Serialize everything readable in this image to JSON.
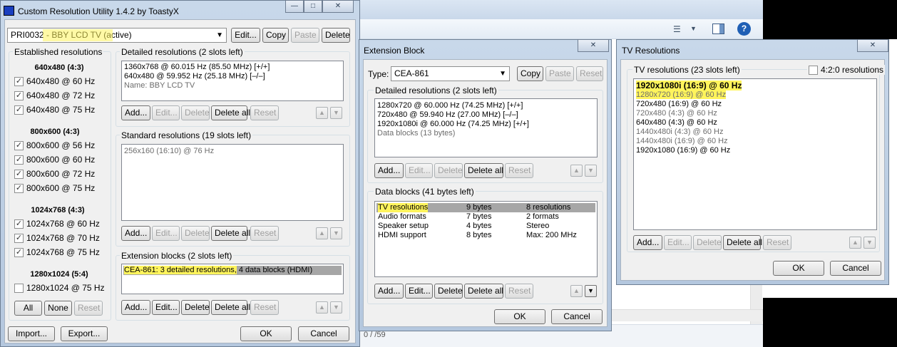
{
  "main_window": {
    "title": "Custom Resolution Utility 1.4.2 by ToastyX",
    "title_buttons": [
      "—",
      "□",
      "✕"
    ],
    "display_select": "PRI0032 - BBY LCD TV (active)",
    "top_buttons": {
      "edit": "Edit...",
      "copy": "Copy",
      "paste": "Paste",
      "delete": "Delete"
    },
    "established": {
      "title": "Established resolutions",
      "groups": [
        {
          "header": "640x480 (4:3)",
          "items": [
            {
              "label": "640x480 @ 60 Hz",
              "checked": true
            },
            {
              "label": "640x480 @ 72 Hz",
              "checked": true
            },
            {
              "label": "640x480 @ 75 Hz",
              "checked": true
            }
          ]
        },
        {
          "header": "800x600 (4:3)",
          "items": [
            {
              "label": "800x600 @ 56 Hz",
              "checked": true
            },
            {
              "label": "800x600 @ 60 Hz",
              "checked": true
            },
            {
              "label": "800x600 @ 72 Hz",
              "checked": true
            },
            {
              "label": "800x600 @ 75 Hz",
              "checked": true
            }
          ]
        },
        {
          "header": "1024x768 (4:3)",
          "items": [
            {
              "label": "1024x768 @ 60 Hz",
              "checked": true
            },
            {
              "label": "1024x768 @ 70 Hz",
              "checked": true
            },
            {
              "label": "1024x768 @ 75 Hz",
              "checked": true
            }
          ]
        },
        {
          "header": "1280x1024 (5:4)",
          "items": [
            {
              "label": "1280x1024 @ 75 Hz",
              "checked": false
            }
          ]
        }
      ],
      "buttons": {
        "all": "All",
        "none": "None",
        "reset": "Reset"
      }
    },
    "detailed": {
      "title": "Detailed resolutions (2 slots left)",
      "rows": [
        "1360x768 @ 60.015 Hz (85.50 MHz) [+/+]",
        "640x480 @ 59.952 Hz (25.18 MHz) [–/–]",
        "Name: BBY LCD TV"
      ]
    },
    "standard": {
      "title": "Standard resolutions (19 slots left)",
      "rows": [
        "256x160 (16:10) @ 76 Hz"
      ]
    },
    "extension": {
      "title": "Extension blocks (2 slots left)",
      "row_hl": "CEA-861: 3 detailed resolutions,",
      "row_rest": " 4 data blocks (HDMI)"
    },
    "list_buttons": {
      "add": "Add...",
      "edit": "Edit...",
      "delete": "Delete",
      "delete_all": "Delete all",
      "reset": "Reset",
      "up": "▲",
      "down": "▼"
    },
    "bottom": {
      "import": "Import...",
      "export": "Export...",
      "ok": "OK",
      "cancel": "Cancel"
    }
  },
  "ext_window": {
    "title": "Extension Block",
    "close": "✕",
    "type_label": "Type:",
    "type_value": "CEA-861",
    "buttons": {
      "copy": "Copy",
      "paste": "Paste",
      "reset": "Reset"
    },
    "detailed": {
      "title": "Detailed resolutions (2 slots left)",
      "rows": [
        "1280x720 @ 60.000 Hz (74.25 MHz) [+/+]",
        "720x480 @ 59.940 Hz (27.00 MHz) [–/–]",
        "1920x1080i @ 60.000 Hz (74.25 MHz) [+/+]",
        "Data blocks (13 bytes)"
      ]
    },
    "data_blocks": {
      "title": "Data blocks (41 bytes left)",
      "rows": [
        {
          "name": "TV resolutions",
          "size": "9 bytes",
          "info": "8 resolutions"
        },
        {
          "name": "Audio formats",
          "size": "7 bytes",
          "info": "2 formats"
        },
        {
          "name": "Speaker setup",
          "size": "4 bytes",
          "info": "Stereo"
        },
        {
          "name": "HDMI support",
          "size": "8 bytes",
          "info": "Max: 200 MHz"
        }
      ]
    },
    "list_buttons": {
      "add": "Add...",
      "edit": "Edit...",
      "delete": "Delete",
      "delete_all": "Delete all",
      "reset": "Reset",
      "up": "▲",
      "down": "▼"
    },
    "ok": "OK",
    "cancel": "Cancel"
  },
  "tv_window": {
    "title": "TV Resolutions",
    "close": "✕",
    "group_title": "TV resolutions (23 slots left)",
    "option_420": "4:2:0 resolutions",
    "rows": [
      {
        "text": "1920x1080i (16:9) @ 60 Hz",
        "style": "native"
      },
      {
        "text": "1280x720 (16:9) @ 60 Hz",
        "style": "hl"
      },
      {
        "text": "720x480 (16:9) @ 60 Hz",
        "style": "normal"
      },
      {
        "text": "720x480 (4:3) @ 60 Hz",
        "style": "gray"
      },
      {
        "text": "640x480 (4:3) @ 60 Hz",
        "style": "normal"
      },
      {
        "text": "1440x480i (4:3) @ 60 Hz",
        "style": "gray"
      },
      {
        "text": "1440x480i (16:9) @ 60 Hz",
        "style": "gray"
      },
      {
        "text": "1920x1080 (16:9) @ 60 Hz",
        "style": "normal"
      }
    ],
    "list_buttons": {
      "add": "Add...",
      "edit": "Edit...",
      "delete": "Delete",
      "delete_all": "Delete all",
      "reset": "Reset",
      "up": "▲",
      "down": "▼"
    },
    "ok": "OK",
    "cancel": "Cancel"
  },
  "background": {
    "toolbar_icons": [
      "view-menu-icon",
      "chevron-down-icon",
      "preview-pane-icon",
      "help-icon"
    ],
    "help_glyph": "?",
    "status_text": "0 / /59"
  }
}
